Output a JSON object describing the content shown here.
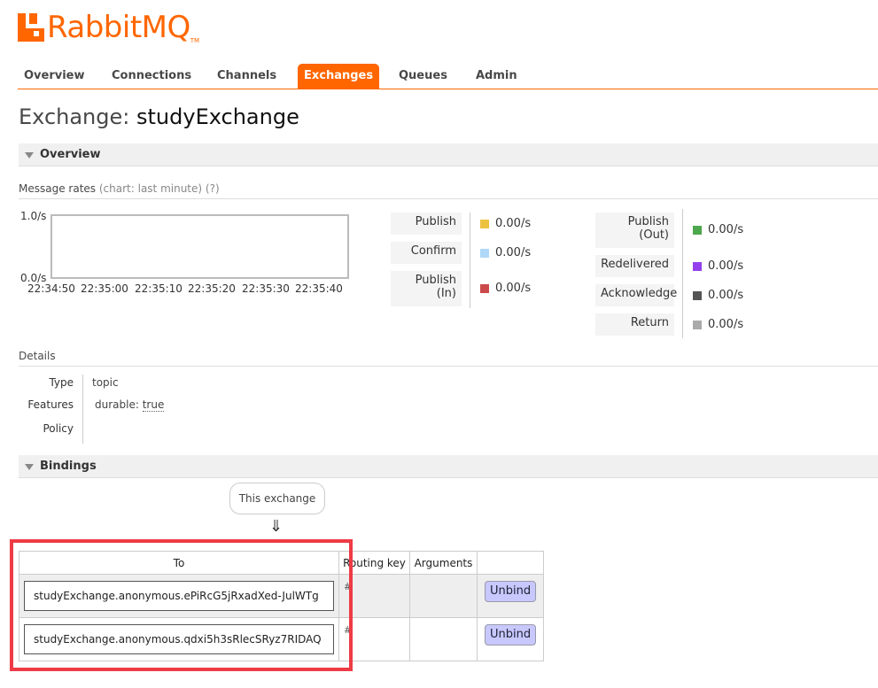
{
  "logo": {
    "text": "RabbitMQ",
    "tm": "TM"
  },
  "nav": {
    "tabs": [
      {
        "label": "Overview",
        "active": false
      },
      {
        "label": "Connections",
        "active": false
      },
      {
        "label": "Channels",
        "active": false
      },
      {
        "label": "Exchanges",
        "active": true
      },
      {
        "label": "Queues",
        "active": false
      },
      {
        "label": "Admin",
        "active": false
      }
    ]
  },
  "page": {
    "title_prefix": "Exchange:",
    "title_name": "studyExchange"
  },
  "overview": {
    "header": "Overview",
    "rates_label": "Message rates",
    "rates_chart": "(chart: last minute)",
    "rates_help": "(?)",
    "chart": {
      "y_top": "1.0/s",
      "y_bottom": "0.0/s",
      "x_ticks": [
        "22:34:50",
        "22:35:00",
        "22:35:10",
        "22:35:20",
        "22:35:30",
        "22:35:40"
      ]
    },
    "legend_left": [
      {
        "label": "Publish",
        "value": "0.00/s",
        "color": "#edc240"
      },
      {
        "label": "Confirm",
        "value": "0.00/s",
        "color": "#afd8f8"
      },
      {
        "label_line1": "Publish",
        "label_line2": "(In)",
        "value": "0.00/s",
        "color": "#cb4b4b"
      }
    ],
    "legend_right": [
      {
        "label_line1": "Publish",
        "label_line2": "(Out)",
        "value": "0.00/s",
        "color": "#4da74d"
      },
      {
        "label": "Redelivered",
        "value": "0.00/s",
        "color": "#9440ed"
      },
      {
        "label": "Acknowledge",
        "value": "0.00/s",
        "color": "#555555"
      },
      {
        "label": "Return",
        "value": "0.00/s",
        "color": "#aaaaaa"
      }
    ]
  },
  "details": {
    "header": "Details",
    "type_label": "Type",
    "type_value": "topic",
    "features_label": "Features",
    "features_key": "durable:",
    "features_value": "true",
    "policy_label": "Policy"
  },
  "bindings": {
    "header": "Bindings",
    "this_exchange": "This exchange",
    "arrow": "⇓",
    "columns": [
      "To",
      "Routing key",
      "Arguments",
      ""
    ],
    "rows": [
      {
        "to": "studyExchange.anonymous.ePiRcG5jRxadXed-JulWTg",
        "routing_key": "#",
        "arguments": "",
        "action": "Unbind"
      },
      {
        "to": "studyExchange.anonymous.qdxi5h3sRlecSRyz7RIDAQ",
        "routing_key": "#",
        "arguments": "",
        "action": "Unbind"
      }
    ]
  }
}
